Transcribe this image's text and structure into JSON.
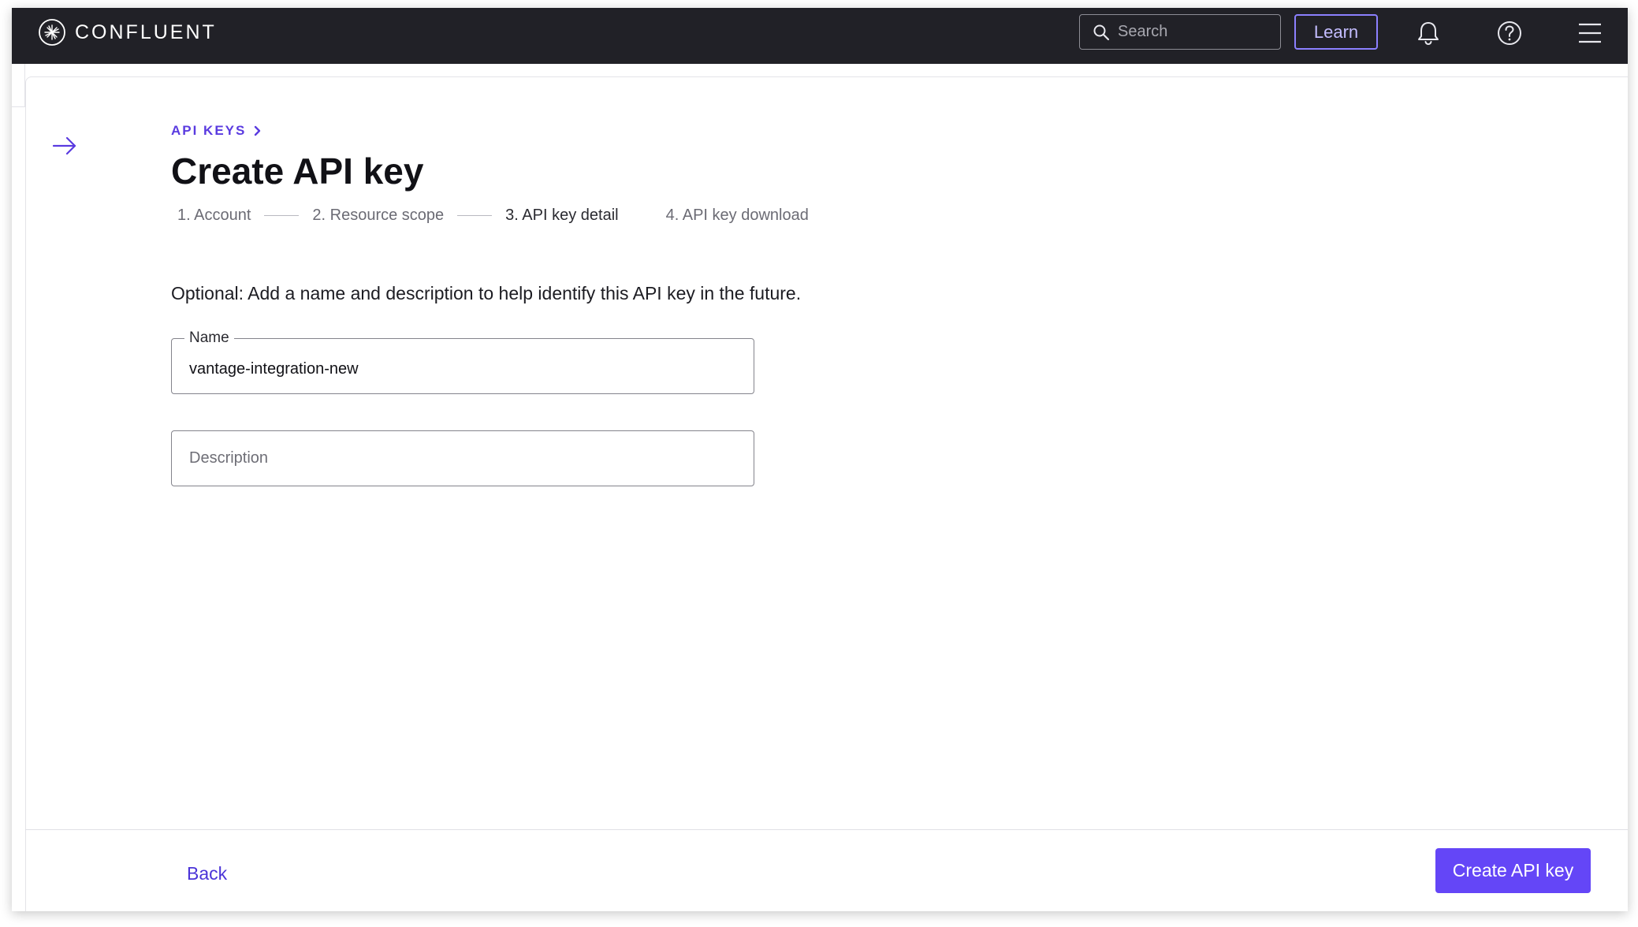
{
  "header": {
    "brand": "CONFLUENT",
    "search_placeholder": "Search",
    "learn_label": "Learn"
  },
  "breadcrumb": {
    "label": "API KEYS"
  },
  "page": {
    "title": "Create API key",
    "intro": "Optional: Add a name and description to help identify this API key in the future."
  },
  "steps": [
    {
      "label": "1. Account",
      "state": "done"
    },
    {
      "label": "2. Resource scope",
      "state": "done"
    },
    {
      "label": "3. API key detail",
      "state": "active"
    },
    {
      "label": "4. API key download",
      "state": "pending"
    }
  ],
  "form": {
    "name_label": "Name",
    "name_value": "vantage-integration-new",
    "description_placeholder": "Description",
    "description_value": ""
  },
  "footer": {
    "back_label": "Back",
    "create_label": "Create API key"
  },
  "colors": {
    "topbar": "#212127",
    "accent": "#6446f7",
    "link": "#4b34d8"
  }
}
